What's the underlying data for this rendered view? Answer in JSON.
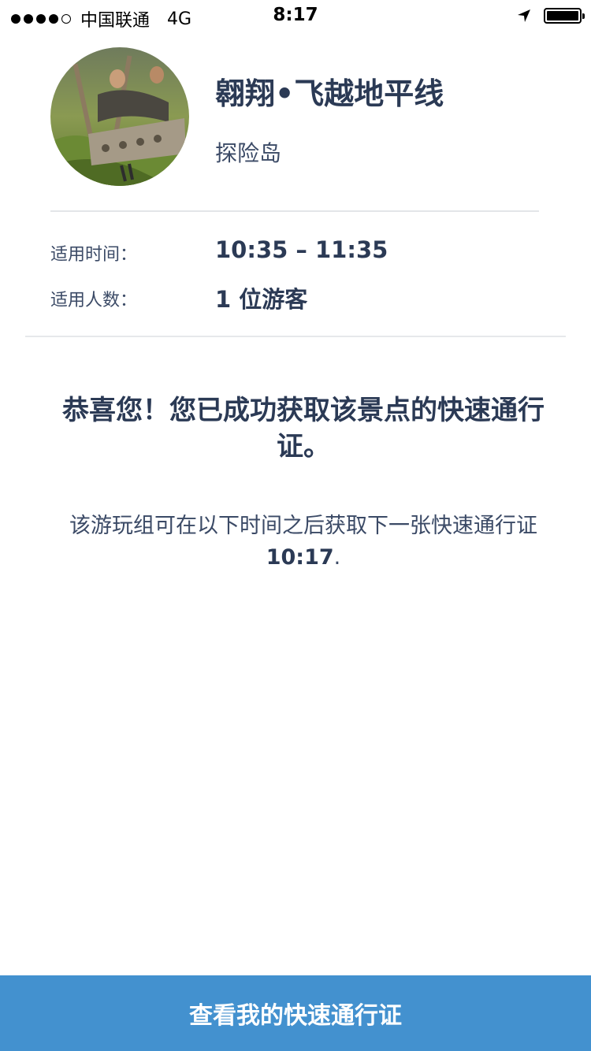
{
  "status_bar": {
    "signal_dots_filled": 4,
    "signal_dots_total": 5,
    "carrier": "中国联通",
    "network": "4G",
    "time": "8:17",
    "location_icon": "location-arrow-icon",
    "battery_icon": "battery-icon",
    "battery_level": 1.0
  },
  "attraction": {
    "name": "翱翔•飞越地平线",
    "land": "探险岛",
    "image_icon": "attraction-thumbnail"
  },
  "details": {
    "time_label": "适用时间：",
    "time_value": "10:35 – 11:35",
    "count_label": "适用人数：",
    "count_value": "1 位游客"
  },
  "message": {
    "congrats": "恭喜您！您已成功获取该景点的快速通行证。",
    "next_prefix": "该游玩组可在以下时间之后获取下一张快速通行证 ",
    "next_time": "10:17",
    "next_suffix": "."
  },
  "footer": {
    "button_label": "查看我的快速通行证"
  },
  "colors": {
    "primary_text": "#2b3a55",
    "button_bg": "#4391cf",
    "divider": "#e3e5e8"
  }
}
